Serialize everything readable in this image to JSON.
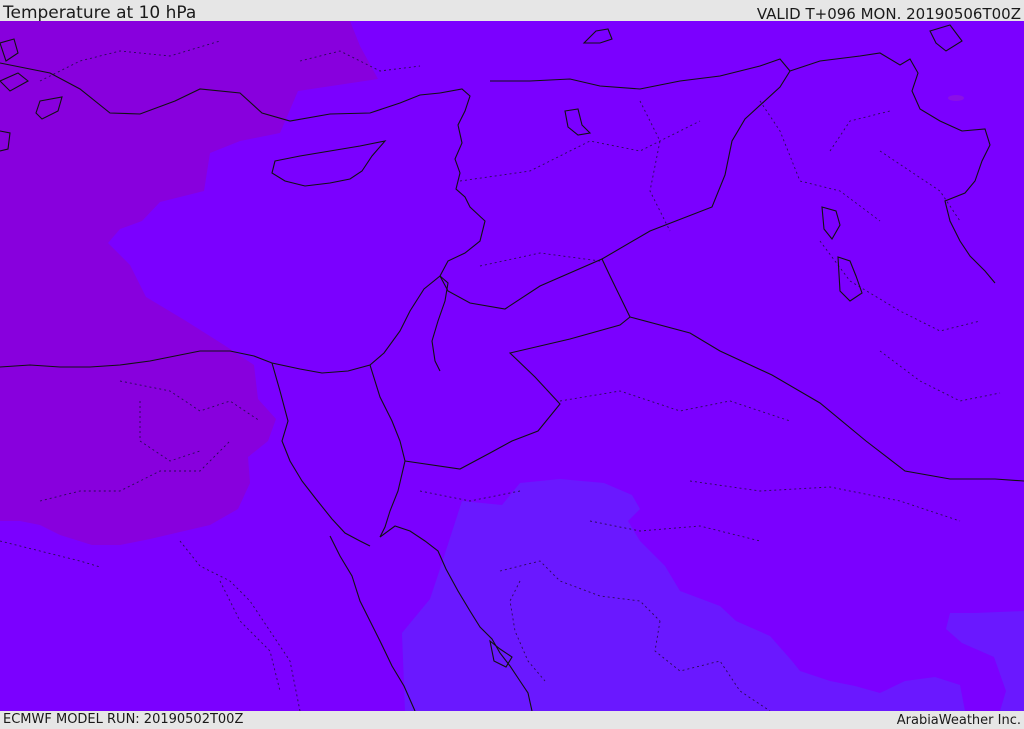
{
  "header": {
    "title": "Temperature at 10 hPa",
    "valid_time": "VALID T+096 MON. 20190506T00Z"
  },
  "footer": {
    "model_run": "ECMWF MODEL RUN: 20190502T00Z",
    "provider": "ArabiaWeather Inc."
  },
  "map": {
    "colors": {
      "background_band": "#7b00ff",
      "cold_band": "#8800dd",
      "warm_band": "#6a18ff",
      "coastline": "#111111",
      "border": "#2a0a55"
    }
  }
}
